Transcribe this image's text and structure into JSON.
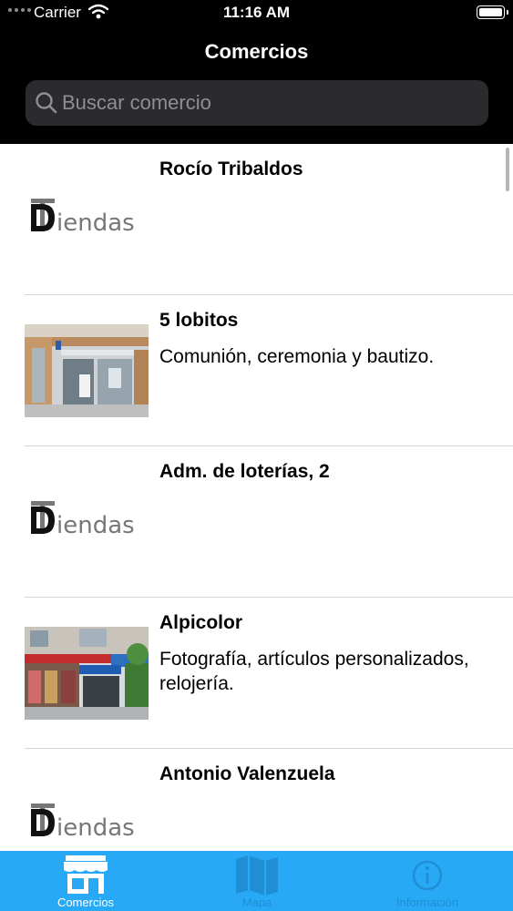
{
  "status": {
    "carrier": "Carrier",
    "time": "11:16 AM"
  },
  "header": {
    "title": "Comercios"
  },
  "search": {
    "placeholder": "Buscar comercio"
  },
  "logo": {
    "text": "Diendas"
  },
  "items": [
    {
      "name": "Rocío Tribaldos",
      "description": "",
      "thumbnail": "logo"
    },
    {
      "name": "5 lobitos",
      "description": "Comunión, ceremonia y bautizo.",
      "thumbnail": "shop-photo"
    },
    {
      "name": "Adm. de loterías, 2",
      "description": "",
      "thumbnail": "logo"
    },
    {
      "name": "Alpicolor",
      "description": "Fotografía, artículos personalizados, relojería.",
      "thumbnail": "shop-photo"
    },
    {
      "name": "Antonio Valenzuela",
      "description": "",
      "thumbnail": "logo"
    }
  ],
  "tabs": [
    {
      "label": "Comercios",
      "icon": "store-icon",
      "active": true
    },
    {
      "label": "Mapa",
      "icon": "map-icon",
      "active": false
    },
    {
      "label": "Información",
      "icon": "info-icon",
      "active": false
    }
  ],
  "colors": {
    "accent": "#28a9f6",
    "header_bg": "#000000",
    "search_bg": "#2b2b2e"
  }
}
